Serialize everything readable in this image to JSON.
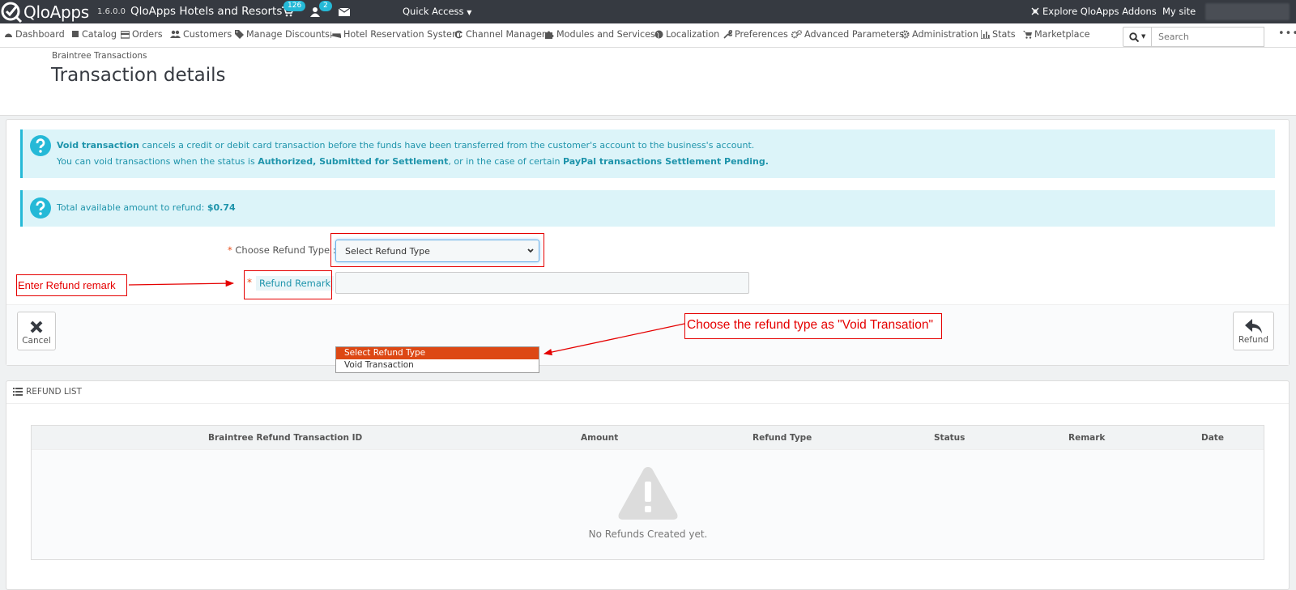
{
  "topbar": {
    "logo": "QloApps",
    "version": "1.6.0.0",
    "shop_name": "QloApps Hotels and Resorts",
    "cart_badge": "126",
    "customer_badge": "2",
    "quick_access": "Quick Access",
    "explore": "Explore QloApps Addons",
    "my_site": "My site"
  },
  "nav": {
    "items": [
      {
        "label": "Dashboard",
        "icon": "dashboard-icon"
      },
      {
        "label": "Catalog",
        "icon": "book-icon"
      },
      {
        "label": "Orders",
        "icon": "credit-card-icon"
      },
      {
        "label": "Customers",
        "icon": "users-icon"
      },
      {
        "label": "Manage Discounts",
        "icon": "tags-icon"
      },
      {
        "label": "Hotel Reservation System",
        "icon": "bed-icon"
      },
      {
        "label": "Channel Manager",
        "icon": "refresh-icon"
      },
      {
        "label": "Modules and Services",
        "icon": "puzzle-icon"
      },
      {
        "label": "Localization",
        "icon": "globe-icon"
      },
      {
        "label": "Preferences",
        "icon": "wrench-icon"
      },
      {
        "label": "Advanced Parameters",
        "icon": "cogs-icon"
      },
      {
        "label": "Administration",
        "icon": "cog-icon"
      },
      {
        "label": "Stats",
        "icon": "bar-chart-icon"
      },
      {
        "label": "Marketplace",
        "icon": "shopping-cart-icon"
      }
    ],
    "search_placeholder": "Search"
  },
  "header": {
    "breadcrumb": "Braintree Transactions",
    "title": "Transaction details"
  },
  "alerts": {
    "void_bold": "Void transaction",
    "void_line1_rest": " cancels a credit or debit card transaction before the funds have been transferred from the customer's account to the business's account.",
    "void_line2_a": "You can void transactions when the status is ",
    "void_line2_b": "Authorized, Submitted for Settlement",
    "void_line2_c": ", or in the case of certain ",
    "void_line2_d": "PayPal transactions Settlement Pending.",
    "total_text": "Total available amount to refund: ",
    "total_amount": "$0.74"
  },
  "form": {
    "refund_type_label": "Choose Refund Type :",
    "refund_type_value": "Select Refund Type",
    "required_mark": "*",
    "remark_label": "Refund Remark",
    "options": [
      "Select Refund Type",
      "Void Transaction"
    ]
  },
  "buttons": {
    "cancel": "Cancel",
    "refund": "Refund"
  },
  "annotations": {
    "remark": "Enter Refund remark",
    "refund_type": "Choose the refund type as \"Void Transation\""
  },
  "refund_list": {
    "title": "Refund List",
    "columns": [
      "Braintree Refund Transaction ID",
      "Amount",
      "Refund Type",
      "Status",
      "Remark",
      "Date"
    ],
    "empty_message": "No Refunds Created yet."
  },
  "colors": {
    "topbar": "#363a41",
    "accent": "#25b9d7",
    "alert_bg": "#dcf4f9",
    "selected_option": "#dd4814",
    "annotation": "#e50000"
  }
}
